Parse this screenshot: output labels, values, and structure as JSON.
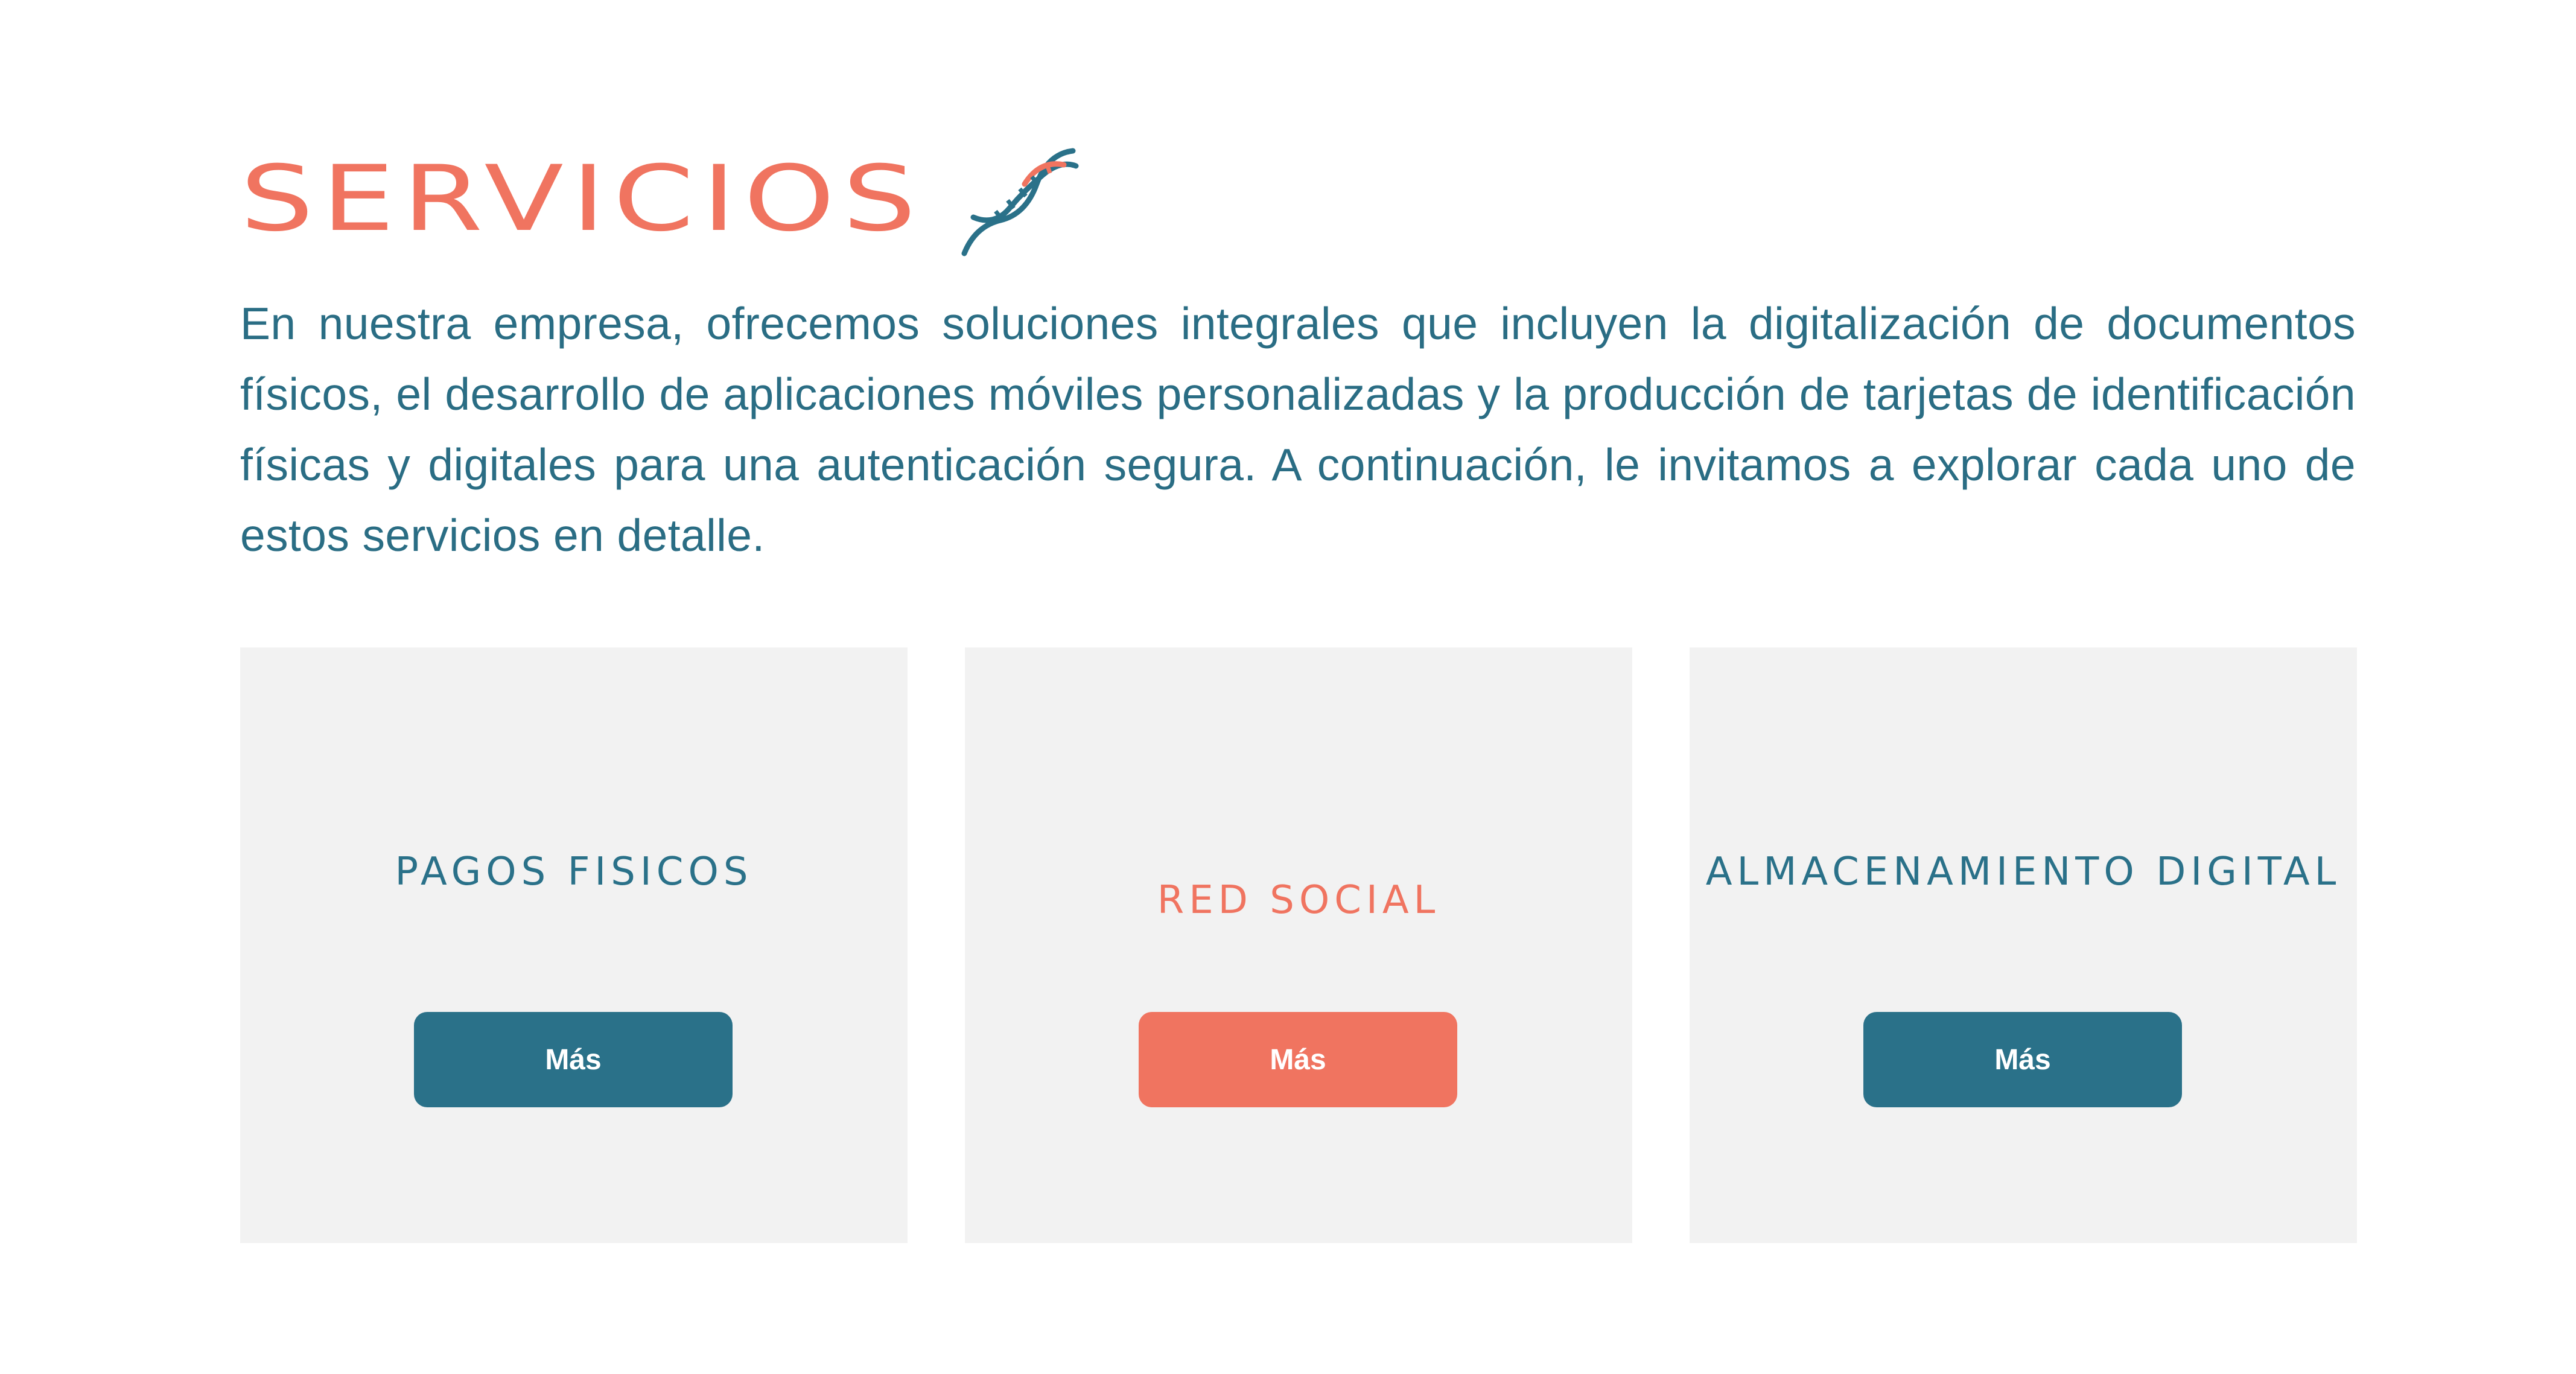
{
  "section": {
    "title": "SERVICIOS",
    "icon": "dna-icon",
    "intro": "En nuestra empresa, ofrecemos soluciones integrales que incluyen la digitalización de documentos físicos, el desarrollo de aplicaciones móviles personalizadas y la producción de tarjetas de identificación físicas y digitales para una autenticación segura. A continuación, le invitamos a explorar cada uno de estos servicios en detalle."
  },
  "cards": [
    {
      "title": "PAGOS FISICOS",
      "button_label": "Más"
    },
    {
      "title": "RED SOCIAL",
      "button_label": "Más"
    },
    {
      "title": "ALMACENAMIENTO DIGITAL",
      "button_label": "Más"
    }
  ],
  "colors": {
    "accent_coral": "#f07460",
    "primary_teal": "#2a7189",
    "text_teal": "#2a6d84",
    "card_background": "#f2f2f2",
    "page_background": "#ffffff"
  }
}
